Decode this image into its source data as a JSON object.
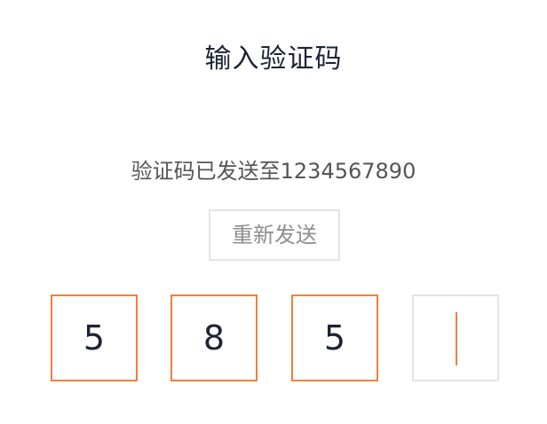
{
  "header": {
    "title": "输入验证码"
  },
  "main": {
    "sent_to_text": "验证码已发送至1234567890",
    "resend_label": "重新发送",
    "code_digits": [
      "5",
      "8",
      "5",
      ""
    ],
    "active_index": 3
  },
  "colors": {
    "accent": "#f07f3c",
    "text_dark": "#1c2434",
    "text_muted": "#8e8e8e",
    "border_light": "#e4e4e4"
  }
}
